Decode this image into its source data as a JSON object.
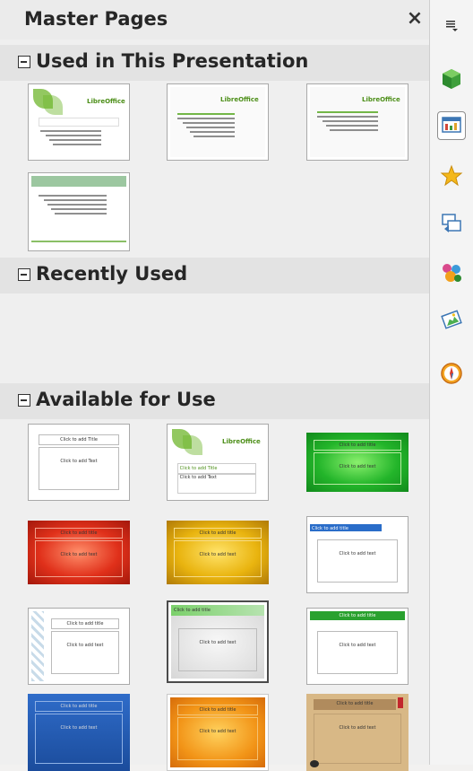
{
  "panel": {
    "title": "Master Pages",
    "close_glyph": "×"
  },
  "sections": {
    "used": {
      "label": "Used in This Presentation"
    },
    "recent": {
      "label": "Recently Used"
    },
    "available": {
      "label": "Available for Use"
    }
  },
  "thumb_text": {
    "libreoffice": "LibreOffice",
    "click_title": "Click to add Title",
    "click_text": "Click to add Text",
    "click_title_lc": "Click to add title",
    "click_text_lc": "Click to add text"
  },
  "sidebar": {
    "menu_icon": "sidebar-menu-icon",
    "items": [
      "properties",
      "master-pages",
      "custom-animation",
      "slide-transition",
      "styles",
      "gallery",
      "navigator"
    ]
  }
}
